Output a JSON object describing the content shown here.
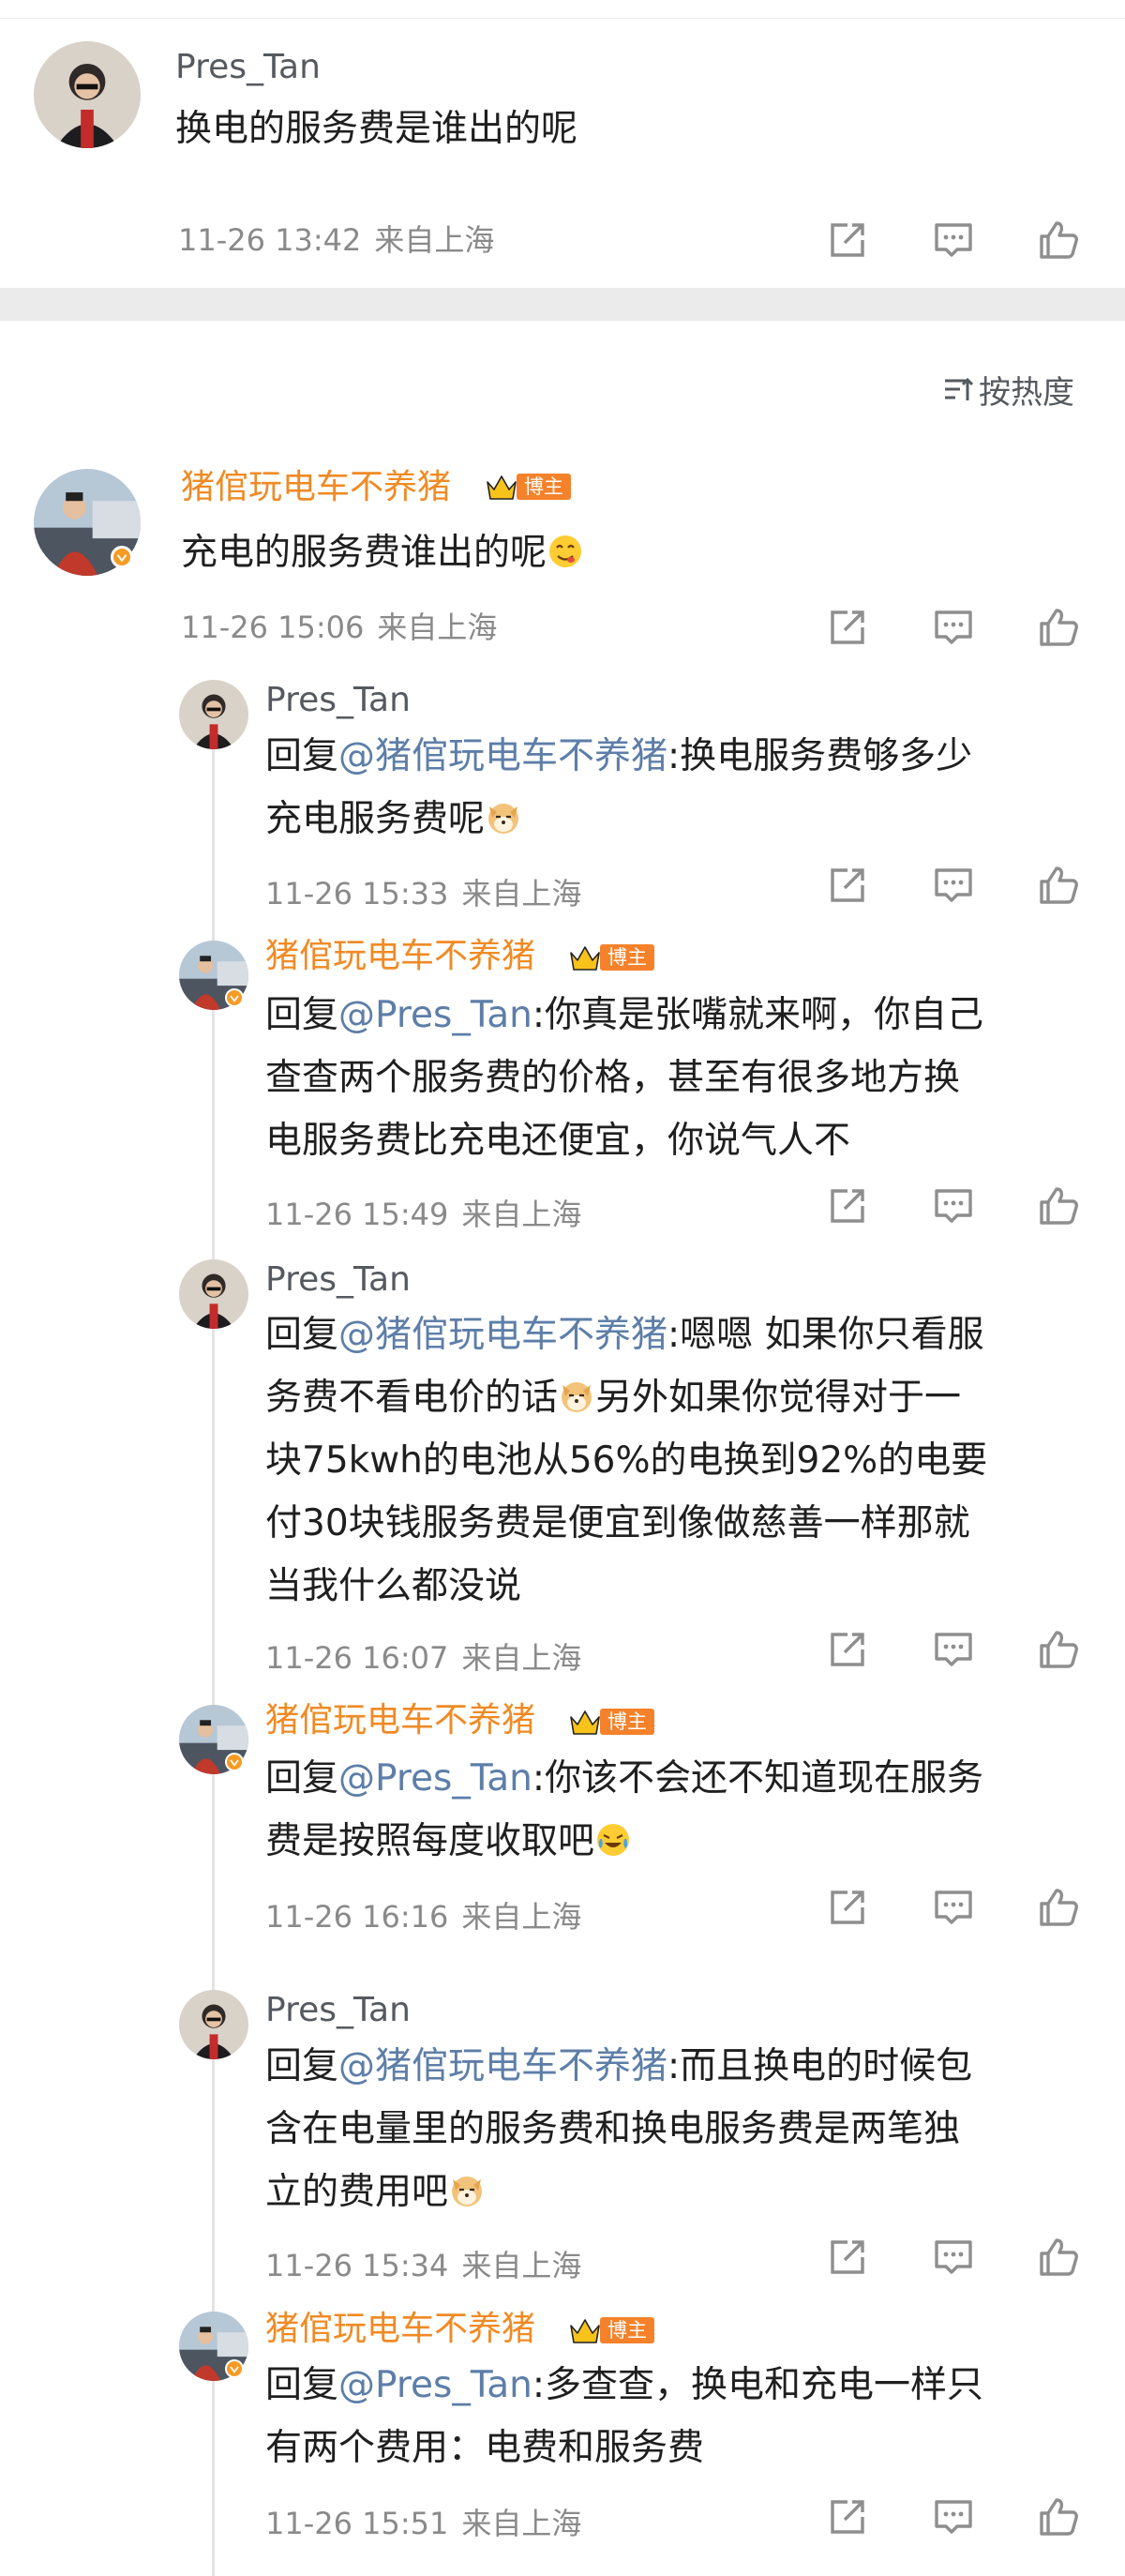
{
  "main_post": {
    "user": "Pres_Tan",
    "text": "换电的服务费是谁出的呢",
    "time": "11-26 13:42",
    "location": "来自上海"
  },
  "sort": {
    "label": "按热度",
    "icon": "sort-icon"
  },
  "badges": {
    "blogger": "博主"
  },
  "comment": {
    "user": "猪倌玩电车不养猪",
    "text": "充电的服务费谁出的呢",
    "emoji": "yum-emoji",
    "time": "11-26 15:06",
    "location": "来自上海"
  },
  "replies": [
    {
      "user": "Pres_Tan",
      "prefix": "回复",
      "mention": "@猪倌玩电车不养猪",
      "lines": [
        ":换电服务费够多少",
        "充电服务费呢"
      ],
      "time": "11-26 15:33",
      "location": "来自上海"
    },
    {
      "user": "猪倌玩电车不养猪",
      "prefix": "回复",
      "mention": "@Pres_Tan",
      "lines": [
        ":你真是张嘴就来啊，你自己",
        "查查两个服务费的价格，甚至有很多地方换",
        "电服务费比充电还便宜，你说气人不"
      ],
      "time": "11-26 15:49",
      "location": "来自上海"
    },
    {
      "user": "Pres_Tan",
      "prefix": "回复",
      "mention": "@猪倌玩电车不养猪",
      "lines": [
        ":嗯嗯 如果你只看服",
        "务费不看电价的话",
        "另外如果你觉得对于一",
        "块75kwh的电池从56%的电换到92%的电要",
        "付30块钱服务费是便宜到像做慈善一样那就",
        "当我什么都没说"
      ],
      "time": "11-26 16:07",
      "location": "来自上海"
    },
    {
      "user": "猪倌玩电车不养猪",
      "prefix": "回复",
      "mention": "@Pres_Tan",
      "lines": [
        ":你该不会还不知道现在服务",
        "费是按照每度收取吧"
      ],
      "time": "11-26 16:16",
      "location": "来自上海"
    },
    {
      "user": "Pres_Tan",
      "prefix": "回复",
      "mention": "@猪倌玩电车不养猪",
      "lines": [
        ":而且换电的时候包",
        "含在电量里的服务费和换电服务费是两笔独",
        "立的费用吧"
      ],
      "time": "11-26 15:34",
      "location": "来自上海"
    },
    {
      "user": "猪倌玩电车不养猪",
      "prefix": "回复",
      "mention": "@Pres_Tan",
      "lines": [
        ":多查查，换电和充电一样只",
        "有两个费用：电费和服务费"
      ],
      "time": "11-26 15:51",
      "location": "来自上海"
    }
  ],
  "actions": {
    "share_icon": "share-icon",
    "comment_icon": "comment-icon",
    "like_icon": "like-icon"
  },
  "colors": {
    "accent_orange": "#f08a24",
    "mention_blue": "#5d7ea8",
    "badge_orange": "#f5822a"
  }
}
